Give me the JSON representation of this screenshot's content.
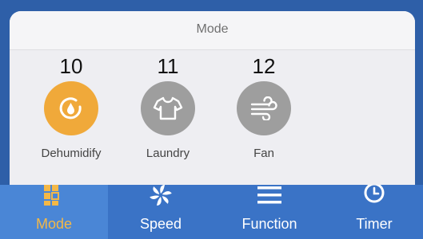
{
  "mode_panel": {
    "title": "Mode",
    "modes": [
      {
        "number": "10",
        "label": "Dehumidify",
        "icon": "dehumidify-icon",
        "active": true
      },
      {
        "number": "11",
        "label": "Laundry",
        "icon": "shirt-icon",
        "active": false
      },
      {
        "number": "12",
        "label": "Fan",
        "icon": "wind-icon",
        "active": false
      }
    ]
  },
  "tabbar": {
    "tabs": [
      {
        "label": "Mode",
        "icon": "mode-grid-icon",
        "active": true
      },
      {
        "label": "Speed",
        "icon": "fan-blade-icon",
        "active": false
      },
      {
        "label": "Function",
        "icon": "menu-lines-icon",
        "active": false
      },
      {
        "label": "Timer",
        "icon": "clock-icon",
        "active": false
      }
    ]
  },
  "colors": {
    "background": "#2e5fa8",
    "tabbar": "#3a73c6",
    "active_mode": "#f0a93a",
    "inactive_mode": "#9e9e9e",
    "active_tab_label": "#f4b847"
  }
}
